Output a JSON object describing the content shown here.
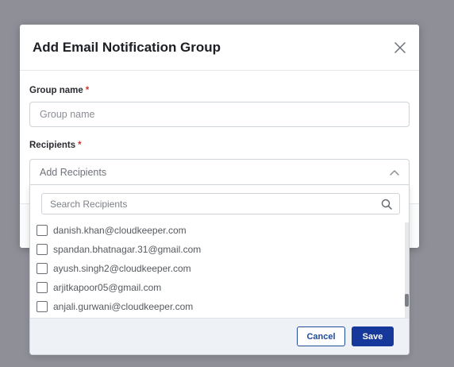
{
  "modal": {
    "title": "Add Email Notification Group",
    "close_icon": "close-icon"
  },
  "group_name": {
    "label": "Group name",
    "required_mark": "*",
    "placeholder": "Group name",
    "value": ""
  },
  "recipients": {
    "label": "Recipients",
    "required_mark": "*",
    "placeholder": "Add Recipients",
    "chevron_icon": "chevron-up-icon",
    "search_placeholder": "Search Recipients",
    "search_icon": "search-icon",
    "items": [
      {
        "email": "danish.khan@cloudkeeper.com",
        "checked": false
      },
      {
        "email": "spandan.bhatnagar.31@gmail.com",
        "checked": false
      },
      {
        "email": "ayush.singh2@cloudkeeper.com",
        "checked": false
      },
      {
        "email": "arjitkapoor05@gmail.com",
        "checked": false
      },
      {
        "email": "anjali.gurwani@cloudkeeper.com",
        "checked": false
      }
    ],
    "cancel_label": "Cancel",
    "save_label": "Save"
  },
  "colors": {
    "primary": "#16389a",
    "required": "#d0342c",
    "overlay": "#8f8f98"
  }
}
